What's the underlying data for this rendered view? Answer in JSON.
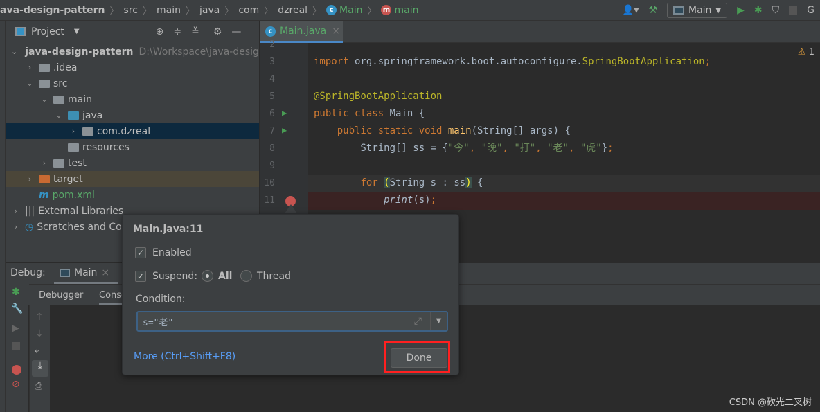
{
  "breadcrumb": [
    "ava-design-pattern",
    "src",
    "main",
    "java",
    "com",
    "dzreal",
    "Main",
    "main"
  ],
  "toolbar": {
    "run_config": "Main",
    "right_letter": "G"
  },
  "project": {
    "title": "Project",
    "tree": [
      {
        "label": "java-design-pattern",
        "path": "D:\\Workspace\\java-design"
      },
      {
        "label": ".idea"
      },
      {
        "label": "src"
      },
      {
        "label": "main"
      },
      {
        "label": "java"
      },
      {
        "label": "com.dzreal"
      },
      {
        "label": "resources"
      },
      {
        "label": "test"
      },
      {
        "label": "target"
      },
      {
        "label": "pom.xml"
      },
      {
        "label": "External Libraries"
      },
      {
        "label": "Scratches and Con"
      }
    ]
  },
  "editor": {
    "tab": "Main.java",
    "warnings": "1",
    "lines": [
      {
        "n": "2",
        "html": ""
      },
      {
        "n": "3",
        "html": "<span class='kw'>import</span> org.springframework.boot.autoconfigure.<span class='ann'>SpringBootApplication</span><span class='kw'>;</span>"
      },
      {
        "n": "4",
        "html": ""
      },
      {
        "n": "5",
        "html": "<span class='ann'>@SpringBootApplication</span>"
      },
      {
        "n": "6",
        "html": "<span class='kw'>public class</span> Main {"
      },
      {
        "n": "7",
        "html": "    <span class='kw'>public static void</span> <span class='fn'>main</span>(String[] args) {"
      },
      {
        "n": "8",
        "html": "        String[] ss = {<span class='str'>\"今\"</span><span class='kw'>,</span> <span class='str'>\"晚\"</span><span class='kw'>,</span> <span class='str'>\"打\"</span><span class='kw'>,</span> <span class='str'>\"老\"</span><span class='kw'>,</span> <span class='str'>\"虎\"</span>}<span class='kw'>;</span>"
      },
      {
        "n": "9",
        "html": ""
      },
      {
        "n": "10",
        "html": "        <span class='kw'>for</span> <span style='color:#ffef28;background:#3b514d'>(</span>String s : ss<span style='color:#ffef28;background:#3b514d'>)</span> {"
      },
      {
        "n": "11",
        "html": "            <span class='it'>print</span>(s)<span class='kw'>;</span>"
      }
    ]
  },
  "debug": {
    "label": "Debug:",
    "tab": "Main",
    "subtabs": [
      "Debugger",
      "Conso"
    ]
  },
  "dialog": {
    "title": "Main.java:11",
    "enabled": "Enabled",
    "enabled_checked": true,
    "suspend": "Suspend:",
    "suspend_checked": true,
    "all": "All",
    "thread": "Thread",
    "suspend_mode": "All",
    "condition_label": "Condition:",
    "condition_value": "s=\"老\"",
    "more": "More (Ctrl+Shift+F8)",
    "done": "Done"
  },
  "watermark": "CSDN @砍光二叉树",
  "colors": {
    "accent": "#4a88c7",
    "highlight_box": "#ff2020",
    "breakpoint": "#c75450"
  }
}
